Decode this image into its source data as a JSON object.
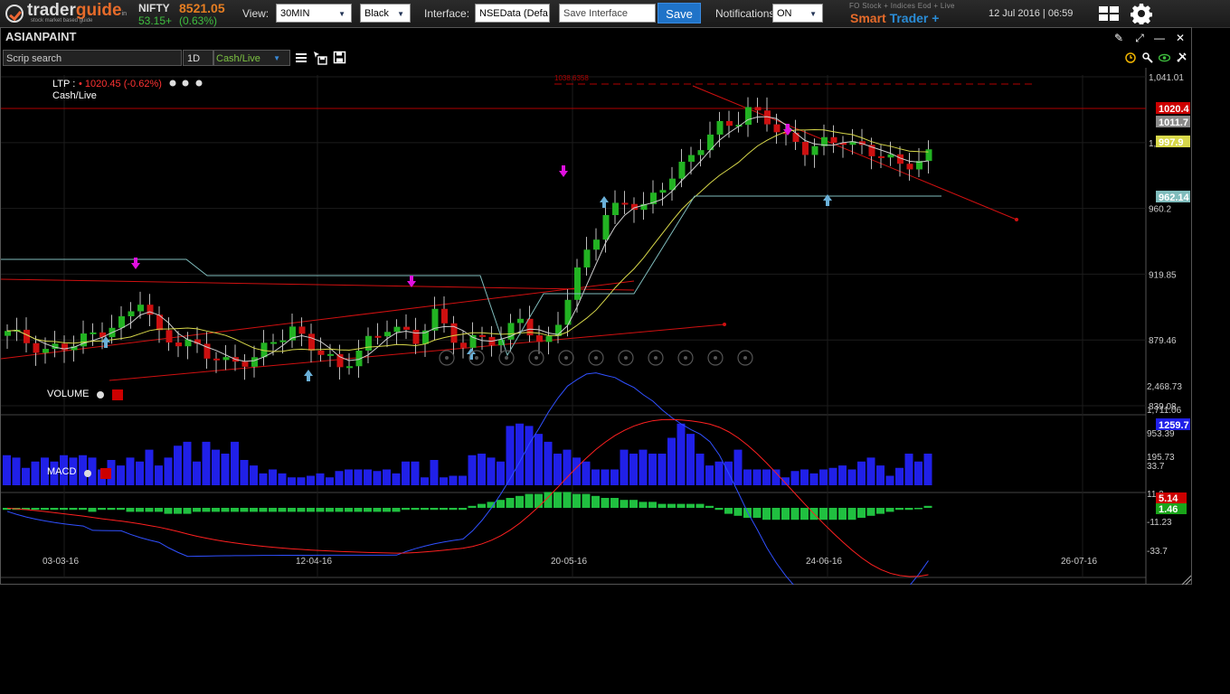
{
  "topbar": {
    "logo": {
      "name_main": "trader",
      "name_accent": "guide",
      "suffix": "in",
      "tagline": "stock market based guide"
    },
    "index": {
      "name": "NIFTY",
      "value": "8521.05",
      "change": "53.15+",
      "change_pct": "(0.63%)"
    },
    "view_label": "View:",
    "view_value": "30MIN",
    "theme_value": "Black",
    "interface_label": "Interface:",
    "interface_value": "NSEData (Defa",
    "save_interface_placeholder": "Save Interface",
    "save_button": "Save",
    "notifications_label": "Notifications:",
    "notifications_value": "ON",
    "promo_line1": "FO Stock + Indices Eod + Live",
    "promo_word1": "Smart",
    "promo_word2": "Trader +",
    "datetime": "12 Jul 2016 | 06:59",
    "colors": {
      "accent": "#e66b2a",
      "save": "#1f73c8",
      "up": "#3fbf3f"
    }
  },
  "window": {
    "symbol": "ASIANPAINT",
    "controls": [
      "pin-icon",
      "expand-icon",
      "minimize-icon",
      "close-icon"
    ],
    "search_placeholder": "Scrip search",
    "period": "1D",
    "feed": "Cash/Live",
    "tool_icons": [
      "menu-icon",
      "cursor-save-icon",
      "floppy-icon"
    ],
    "right_tools": [
      "clock-icon",
      "wrench-icon",
      "eye-icon",
      "tools-icon"
    ]
  },
  "chart_data": {
    "type": "candlestick",
    "ltp_label": "LTP :",
    "ltp_text": "• 1020.45 (-0.62%)",
    "feed_label": "Cash/Live",
    "price_axis": [
      "1,041.01",
      "1,000.6",
      "960.2",
      "919.85",
      "879.46",
      "839.08"
    ],
    "price_badges": [
      {
        "text": "1020.4",
        "bg": "#cc0000"
      },
      {
        "text": "1011.7",
        "bg": "#8a8a8a"
      },
      {
        "text": "997.9",
        "bg": "#d8d84a"
      },
      {
        "text": "962.14",
        "bg": "#7fbcbc"
      }
    ],
    "top_annotation": "1038.6358",
    "x_labels": [
      "03-03-16",
      "12-04-16",
      "20-05-16",
      "24-06-16",
      "26-07-16"
    ],
    "volume": {
      "title": "VOLUME",
      "axis": [
        "2,468.73",
        "1,711.06",
        "953.39",
        "195.73"
      ],
      "badge": "1259.7",
      "bars": [
        38,
        35,
        22,
        30,
        35,
        30,
        38,
        35,
        38,
        35,
        20,
        32,
        25,
        35,
        30,
        45,
        25,
        35,
        50,
        55,
        30,
        55,
        45,
        40,
        55,
        32,
        25,
        15,
        20,
        15,
        10,
        10,
        12,
        15,
        10,
        18,
        20,
        20,
        20,
        18,
        20,
        15,
        30,
        30,
        10,
        32,
        10,
        12,
        12,
        38,
        40,
        35,
        30,
        75,
        78,
        75,
        65,
        55,
        40,
        45,
        35,
        30,
        20,
        20,
        20,
        45,
        40,
        45,
        40,
        40,
        60,
        78,
        65,
        40,
        25,
        30,
        30,
        45,
        20,
        20,
        20,
        20,
        10,
        18,
        20,
        15,
        20,
        22,
        25,
        20,
        30,
        35,
        25,
        12,
        22,
        40,
        30,
        40
      ]
    },
    "macd": {
      "title": "MACD",
      "axis": [
        "33.7",
        "11.2",
        "-11.23",
        "-33.7"
      ],
      "badges": [
        {
          "text": "5.14",
          "bg": "#cc0000"
        },
        {
          "text": "1.46",
          "bg": "#1aa41a"
        }
      ],
      "hist": [
        -1,
        -1,
        -1,
        -1,
        -1,
        -1,
        -1,
        -1,
        -1,
        -2,
        -1,
        -1,
        -1,
        -2,
        -2,
        -2,
        -2,
        -3,
        -3,
        -3,
        -2,
        -2,
        -2,
        -2,
        -2,
        -2,
        -2,
        -2,
        -2,
        -2,
        -2,
        -2,
        -2,
        -2,
        -2,
        -2,
        -2,
        -2,
        -2,
        -2,
        -2,
        -2,
        -1,
        -1,
        -1,
        -1,
        -1,
        -1,
        -1,
        1,
        2,
        3,
        4,
        5,
        6,
        7,
        7,
        8,
        8,
        8,
        7,
        7,
        6,
        5,
        5,
        4,
        4,
        3,
        3,
        2,
        2,
        2,
        2,
        2,
        1,
        -1,
        -3,
        -4,
        -5,
        -5,
        -6,
        -6,
        -6,
        -6,
        -6,
        -6,
        -6,
        -6,
        -6,
        -6,
        -5,
        -4,
        -3,
        -2,
        -1,
        -1,
        0,
        1
      ]
    },
    "nav_buttons": [
      "first-icon",
      "prev-icon",
      "zoom-in-icon",
      "fit-icon",
      "reset-icon",
      "refresh-icon",
      "pan-icon",
      "expand-h-icon",
      "zoom-out-icon",
      "next-icon",
      "last-icon"
    ]
  }
}
